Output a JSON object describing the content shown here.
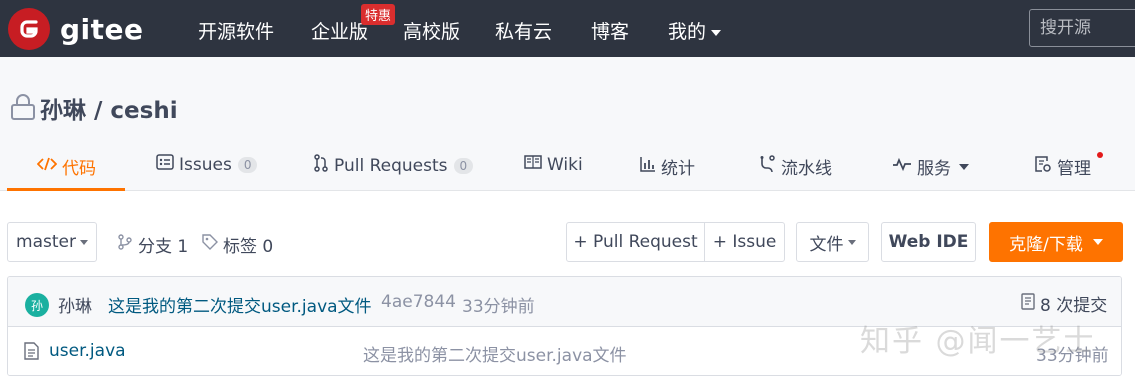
{
  "logo": {
    "text": "gitee"
  },
  "nav": {
    "items": [
      "开源软件",
      "企业版",
      "高校版",
      "私有云",
      "博客",
      "我的"
    ],
    "badge": "特惠"
  },
  "search": {
    "placeholder": "搜开源"
  },
  "repo": {
    "title": "孙琳 / ceshi"
  },
  "tabs": {
    "code": "代码",
    "issues": "Issues",
    "issues_count": "0",
    "pulls": "Pull Requests",
    "pulls_count": "0",
    "wiki": "Wiki",
    "stats": "统计",
    "pipeline": "流水线",
    "services": "服务",
    "manage": "管理"
  },
  "toolbar": {
    "branch": "master",
    "branches": "分支 1",
    "tags": "标签 0",
    "pull_request": "+ Pull Request",
    "issue": "+ Issue",
    "file": "文件",
    "web_ide": "Web IDE",
    "clone": "克隆/下载"
  },
  "commit": {
    "avatar": "孙",
    "author": "孙琳",
    "message": "这是我的第二次提交user.java文件",
    "hash": "4ae7844",
    "time": "33分钟前",
    "count": "8 次提交"
  },
  "files": [
    {
      "name": "user.java",
      "message": "这是我的第二次提交user.java文件",
      "time": "33分钟前"
    }
  ],
  "watermark": "知乎 @闻一艺士",
  "colors": {
    "topbar": "#2e3440",
    "accent": "#fe7300",
    "logo": "#c71d23",
    "link": "#005980"
  }
}
